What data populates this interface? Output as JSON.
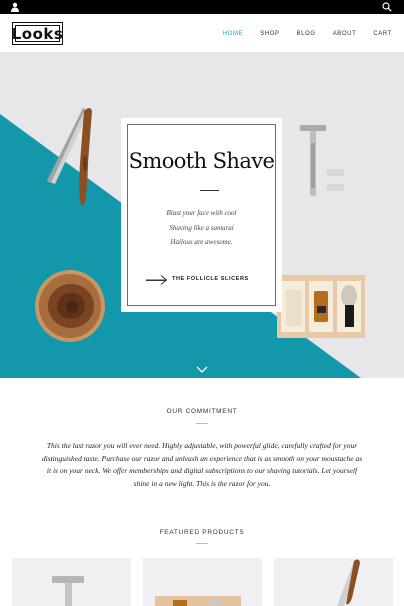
{
  "topbar": {
    "user_icon": "user-icon",
    "search_icon": "search-icon"
  },
  "header": {
    "logo_text": "Looks",
    "nav": [
      {
        "label": "HOME",
        "active": true
      },
      {
        "label": "SHOP",
        "active": false
      },
      {
        "label": "BLOG",
        "active": false
      },
      {
        "label": "ABOUT",
        "active": false
      },
      {
        "label": "CART",
        "active": false
      }
    ]
  },
  "hero": {
    "title": "Smooth Shave",
    "lines": [
      "Blast your face with cool",
      "Shaving like a samurai",
      "Hailous are awesome."
    ],
    "cta_label": "THE FOLLICLE SLICERS",
    "scroll_icon": "chevron-down-icon"
  },
  "commitment": {
    "title": "OUR COMMITMENT",
    "text": "This the last razor you will ever need.  Highly adjustable, with powerful glide, carefully crafted for your distinguished taste.  Purchase our razor and unleash an experience that is as smooth on your moustache as it is on your neck.  We offer memberships and digital subscriptions to our shaving tutorials.  Let yourself shine in a new light.  This is the razor for you."
  },
  "featured": {
    "title": "FEATURED PRODUCTS",
    "items": [
      "safety-razor-product",
      "shaving-kit-product",
      "straight-razor-product"
    ]
  },
  "colors": {
    "accent": "#2aa0b0",
    "teal": "#1397ab",
    "hero_bg": "#e7e7e9"
  }
}
